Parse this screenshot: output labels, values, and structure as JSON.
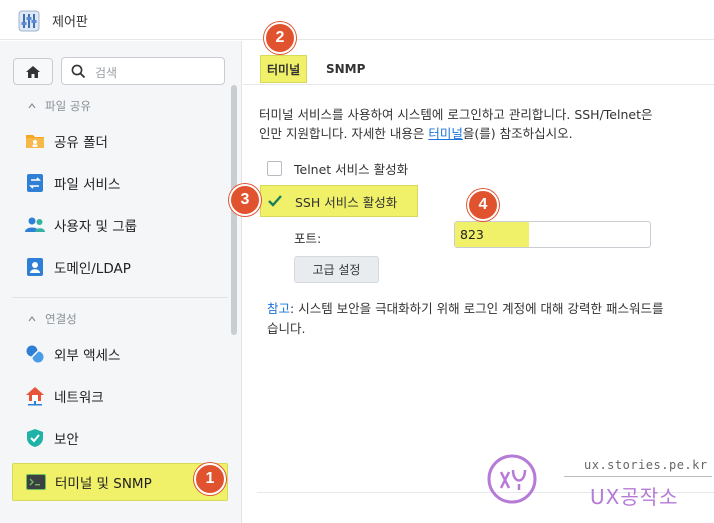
{
  "window": {
    "title": "제어판"
  },
  "sidebar": {
    "search_placeholder": "검색",
    "groups": [
      {
        "label": "파일 공유"
      },
      {
        "label": "연결성"
      }
    ],
    "items": [
      {
        "label": "공유 폴더",
        "icon": "shared-folder-icon"
      },
      {
        "label": "파일 서비스",
        "icon": "file-services-icon"
      },
      {
        "label": "사용자 및 그룹",
        "icon": "user-group-icon"
      },
      {
        "label": "도메인/LDAP",
        "icon": "domain-ldap-icon"
      },
      {
        "label": "외부 액세스",
        "icon": "external-access-icon"
      },
      {
        "label": "네트워크",
        "icon": "network-icon"
      },
      {
        "label": "보안",
        "icon": "security-shield-icon"
      },
      {
        "label": "터미널 및 SNMP",
        "icon": "terminal-icon"
      }
    ]
  },
  "tabs": [
    {
      "label": "터미널"
    },
    {
      "label": "SNMP"
    }
  ],
  "terminal": {
    "desc_line1": "터미널 서비스를 사용하여 시스템에 로그인하고 관리합니다. SSH/Telnet은",
    "desc_line2_pre": "인만 지원합니다. 자세한 내용은 ",
    "desc_link": "터미널",
    "desc_line2_post": "을(를) 참조하십시오.",
    "telnet_label": "Telnet 서비스 활성화",
    "ssh_label": "SSH 서비스 활성화",
    "port_label": "포트:",
    "port_value": "823",
    "advanced_button": "고급 설정",
    "note_label": "참고",
    "note_line1": ": 시스템 보안을 극대화하기 위해 로그인 계정에 대해 강력한 패스워드를",
    "note_line2": "습니다."
  },
  "badges": [
    "1",
    "2",
    "3",
    "4"
  ],
  "watermark": {
    "domain": "ux.stories.pe.kr",
    "name": "UX공작소"
  },
  "colors": {
    "highlight": "#f0f169",
    "badge": "#e0532e",
    "link": "#1b74d9",
    "check": "#1a7f5a"
  }
}
